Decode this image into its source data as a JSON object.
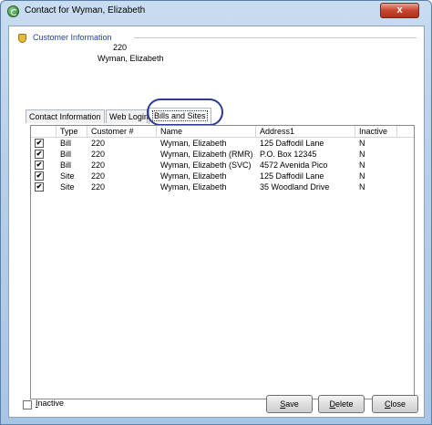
{
  "window": {
    "title": "Contact for Wyman, Elizabeth",
    "close_glyph": "x"
  },
  "customer_info": {
    "section_title": "Customer Information",
    "number": "220",
    "name": "Wyman, Elizabeth"
  },
  "tabs": [
    {
      "label": "Contact Information"
    },
    {
      "label": "Web Login"
    },
    {
      "label": "Bills and Sites",
      "selected": true
    }
  ],
  "grid": {
    "columns": [
      "",
      "Type",
      "Customer #",
      "Name",
      "Address1",
      "Inactive"
    ],
    "rows": [
      {
        "checked": true,
        "type": "Bill",
        "customer": "220",
        "name": "Wyman, Elizabeth",
        "address": "125 Daffodil Lane",
        "inactive": "N"
      },
      {
        "checked": true,
        "type": "Bill",
        "customer": "220",
        "name": "Wyman, Elizabeth (RMR)",
        "address": "P.O. Box 12345",
        "inactive": "N"
      },
      {
        "checked": true,
        "type": "Bill",
        "customer": "220",
        "name": "Wyman, Elizabeth (SVC)",
        "address": "4572 Avenida Pico",
        "inactive": "N"
      },
      {
        "checked": true,
        "type": "Site",
        "customer": "220",
        "name": "Wyman, Elizabeth",
        "address": "125 Daffodil Lane",
        "inactive": "N"
      },
      {
        "checked": true,
        "type": "Site",
        "customer": "220",
        "name": "Wyman, Elizabeth",
        "address": "35 Woodland Drive",
        "inactive": "N"
      }
    ]
  },
  "footer": {
    "inactive_label": "Inactive",
    "inactive_checked": false,
    "save_label": "Save",
    "delete_label": "Delete",
    "close_label": "Close"
  },
  "check_glyph": "✔",
  "colors": {
    "section_title": "#1f3f99",
    "close_button": "#c7452f",
    "tab_highlight": "#2a3c93"
  }
}
